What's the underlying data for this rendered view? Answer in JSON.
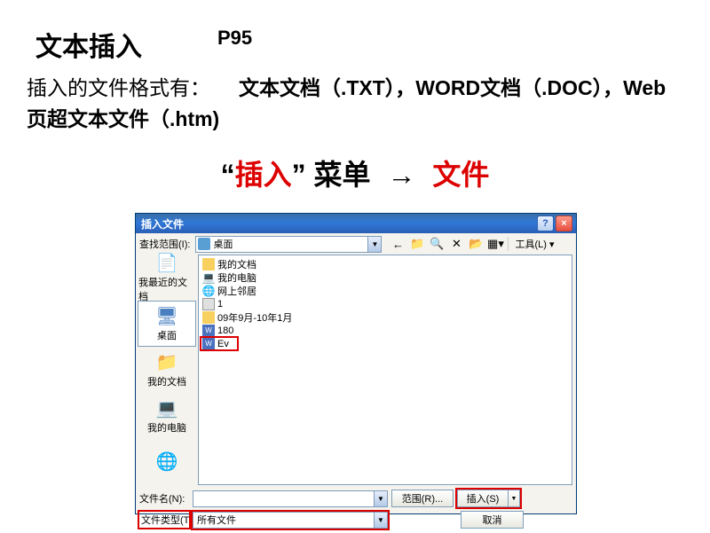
{
  "title": "文本插入",
  "pageRef": "P95",
  "description": {
    "prefix": "插入的文件格式有：",
    "formats": "文本文档（.TXT），WORD文档（.DOC），Web页超文本文件（.htm)"
  },
  "menuPath": {
    "quoteL": "“",
    "insert": "插入",
    "quoteR": "”",
    "menu": "菜单",
    "arrow": "→",
    "file": "文件"
  },
  "dialog": {
    "title": "插入文件",
    "help": "?",
    "close": "×",
    "lookInLabel": "查找范围(I):",
    "lookInValue": "桌面",
    "toolbar": {
      "back": "←",
      "up": "↑",
      "search": "⌕",
      "delete": "✕",
      "newFolder": "▢",
      "views": "≣",
      "toolsLabel": "工具(L)"
    },
    "places": [
      {
        "label": "我最近的文档",
        "icon": "recent"
      },
      {
        "label": "桌面",
        "icon": "desktop"
      },
      {
        "label": "我的文档",
        "icon": "folder"
      },
      {
        "label": "我的电脑",
        "icon": "computer"
      },
      {
        "label": "",
        "icon": "network"
      }
    ],
    "files": [
      {
        "name": "我的文档",
        "icon": "folder"
      },
      {
        "name": "我的电脑",
        "icon": "computer"
      },
      {
        "name": "网上邻居",
        "icon": "network"
      },
      {
        "name": "1",
        "icon": "txt"
      },
      {
        "name": "09年9月-10年1月",
        "icon": "folder"
      },
      {
        "name": "180",
        "icon": "doc"
      },
      {
        "name": "Ev",
        "icon": "doc",
        "highlighted": true
      }
    ],
    "fileNameLabel": "文件名(N):",
    "fileNameValue": "",
    "fileTypeLabel": "文件类型(T):",
    "fileTypeValue": "所有文件",
    "rangeBtn": "范围(R)...",
    "insertBtn": "插入(S)",
    "cancelBtn": "取消"
  }
}
